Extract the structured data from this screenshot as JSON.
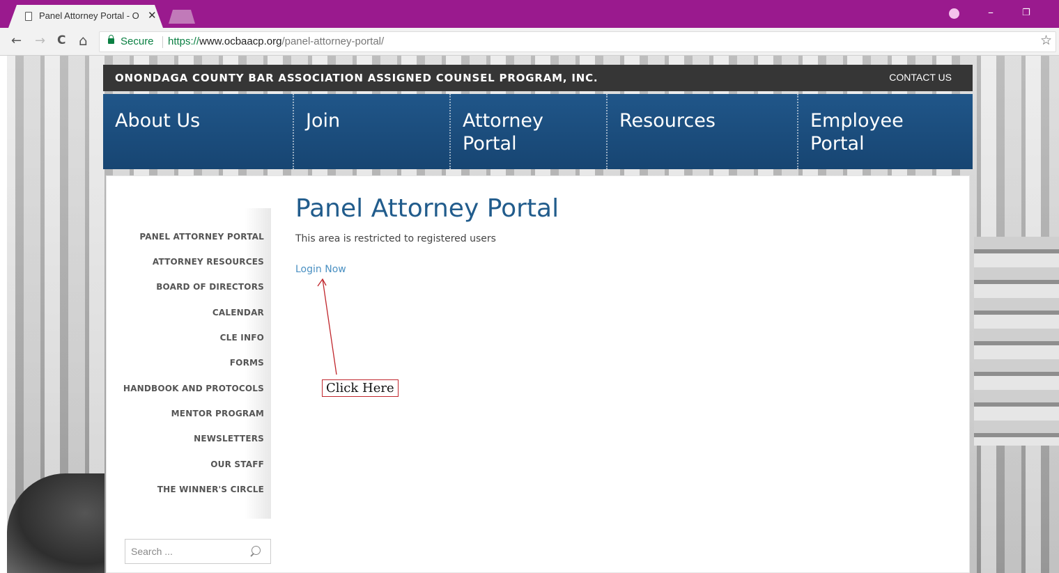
{
  "browser": {
    "tab_title": "Panel Attorney Portal - O",
    "close_glyph": "✕",
    "back_glyph": "←",
    "forward_glyph": "→",
    "reload_glyph": "C",
    "home_glyph": "⌂",
    "secure_label": "Secure",
    "url_scheme": "https://",
    "url_host": "www.ocbaacp.org",
    "url_path": "/panel-attorney-portal/",
    "star_glyph": "☆",
    "minimize_glyph": "–",
    "restore_glyph": "❐",
    "titlebar_color": "#9a1a8e"
  },
  "site": {
    "org_name": "ONONDAGA COUNTY BAR ASSOCIATION ASSIGNED COUNSEL PROGRAM, INC.",
    "contact_label": "CONTACT US",
    "nav_color": "#1e5285",
    "nav": [
      {
        "line1": "About Us",
        "line2": ""
      },
      {
        "line1": "Join",
        "line2": ""
      },
      {
        "line1": "Attorney",
        "line2": "Portal"
      },
      {
        "line1": "Resources",
        "line2": ""
      },
      {
        "line1": "Employee",
        "line2": "Portal"
      }
    ]
  },
  "sidebar": {
    "links": [
      "PANEL ATTORNEY PORTAL",
      "ATTORNEY RESOURCES",
      "BOARD OF DIRECTORS",
      "CALENDAR",
      "CLE INFO",
      "FORMS",
      "HANDBOOK AND PROTOCOLS",
      "MENTOR PROGRAM",
      "NEWSLETTERS",
      "OUR STAFF",
      "THE WINNER'S CIRCLE"
    ],
    "search_placeholder": "Search ..."
  },
  "main": {
    "title": "Panel Attorney Portal",
    "restricted_text": "This area is restricted to registered users",
    "login_link": "Login Now",
    "annotation_label": "Click Here",
    "title_color": "#215c8c",
    "annotation_color": "#c0262c"
  }
}
